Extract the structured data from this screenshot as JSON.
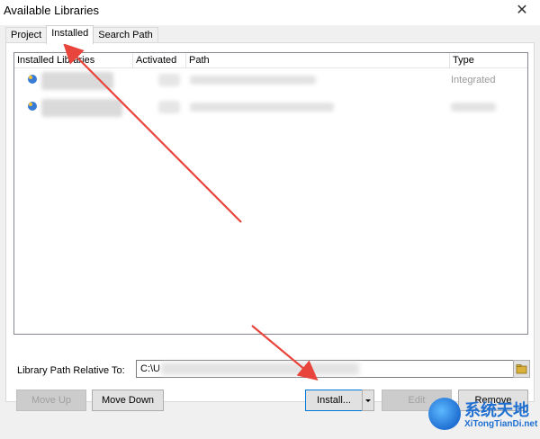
{
  "window": {
    "title": "Available Libraries",
    "close_glyph": "✕"
  },
  "tabs": [
    {
      "label": "Project",
      "active": false
    },
    {
      "label": "Installed",
      "active": true
    },
    {
      "label": "Search Path",
      "active": false
    }
  ],
  "list": {
    "columns": [
      "Installed Libraries",
      "Activated",
      "Path",
      "Type"
    ],
    "rows": [
      {
        "type": "Integrated"
      },
      {
        "type": ""
      }
    ]
  },
  "path": {
    "label": "Library Path Relative To:",
    "value": "C:\\U"
  },
  "buttons": {
    "move_up": "Move Up",
    "move_down": "Move Down",
    "install": "Install...",
    "edit": "Edit",
    "remove": "Remove"
  },
  "watermark": {
    "title": "系统天地",
    "url": "XiTongTianDi.net"
  },
  "colors": {
    "annotation_arrow": "#e8453c",
    "accent": "#0078d7"
  }
}
